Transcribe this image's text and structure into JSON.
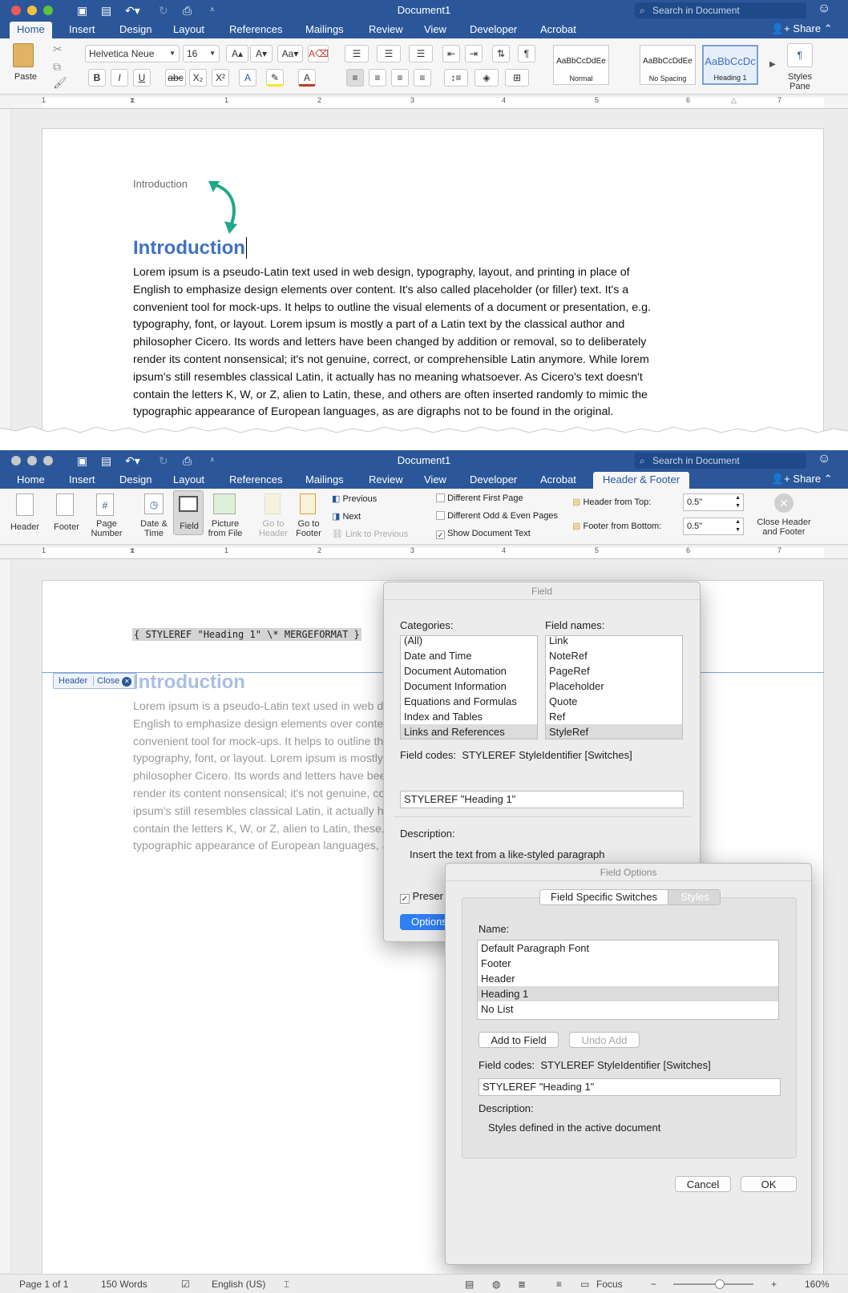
{
  "app": {
    "title": "Document1",
    "search_placeholder": "Search in Document",
    "share_label": "Share",
    "accent": "#2b579a"
  },
  "tabs": [
    {
      "label": "Home"
    },
    {
      "label": "Insert"
    },
    {
      "label": "Design"
    },
    {
      "label": "Layout"
    },
    {
      "label": "References"
    },
    {
      "label": "Mailings"
    },
    {
      "label": "Review"
    },
    {
      "label": "View"
    },
    {
      "label": "Developer"
    },
    {
      "label": "Acrobat"
    }
  ],
  "context_tab": {
    "label": "Header & Footer"
  },
  "home_ribbon": {
    "paste_label": "Paste",
    "font_name": "Helvetica Neue",
    "font_size": "16",
    "styles": [
      {
        "preview": "AaBbCcDdEe",
        "name": "Normal"
      },
      {
        "preview": "AaBbCcDdEe",
        "name": "No Spacing"
      },
      {
        "preview": "AaBbCcDc",
        "name": "Heading 1"
      }
    ],
    "styles_pane_label": "Styles Pane"
  },
  "hf_ribbon": {
    "header_label": "Header",
    "footer_label": "Footer",
    "page_number_label": "Page Number",
    "date_time_label": "Date & Time",
    "field_label": "Field",
    "picture_label": "Picture from File",
    "goto_header_label": "Go to Header",
    "goto_footer_label": "Go to Footer",
    "previous_label": "Previous",
    "next_label": "Next",
    "link_previous_label": "Link to Previous",
    "diff_first_label": "Different First Page",
    "diff_odd_even_label": "Different Odd & Even Pages",
    "show_doc_text_label": "Show Document Text",
    "header_from_top_label": "Header from Top:",
    "header_from_top_value": "0.5\"",
    "footer_from_bottom_label": "Footer from Bottom:",
    "footer_from_bottom_value": "0.5\"",
    "close_label": "Close Header and Footer"
  },
  "document": {
    "header_text": "Introduction",
    "heading": "Introduction",
    "body": "Lorem ipsum is a pseudo-Latin text used in web design, typography, layout, and printing in place of English to emphasize design elements over content. It's also called placeholder (or filler) text. It's a convenient tool for mock-ups. It helps to outline the visual elements of a document or presentation, e.g. typography, font, or layout. Lorem ipsum is mostly a part of a Latin text by the classical author and philosopher Cicero. Its words and letters have been changed by addition or removal, so to deliberately render its content nonsensical; it's not genuine, correct, or comprehensible Latin anymore. While lorem ipsum's still resembles classical Latin, it actually has no meaning whatsoever. As Cicero's text doesn't contain the letters K, W, or Z, alien to Latin, these, and others are often inserted randomly to mimic the typographic appearance of European languages, as are digraphs not to be found in the original.",
    "body_lines": [
      "Lorem ipsum is a pseudo-Latin text used in web design, typography, layout, and printing in place of",
      "English to emphasize design elements over content. It's also called placeholder (or filler) text. It's a",
      "convenient tool for mock-ups. It helps to outline the visual elements of a document or presentation, e.g.",
      "typography, font, or layout. Lorem ipsum is mostly a part of a Latin text by the classical author and",
      "philosopher Cicero. Its words and letters have been changed by addition or removal, so to deliberately",
      "render its content nonsensical; it's not genuine, correct, or comprehensible Latin anymore. While lorem",
      "ipsum's still resembles classical Latin, it actually has no meaning whatsoever. As Cicero's text doesn't",
      "contain the letters K, W, or Z, alien to Latin, these, and others are often inserted randomly to mimic the",
      "typographic appearance of European languages, as are digraphs not to be found in the original."
    ],
    "field_code": "{ STYLEREF \"Heading 1\" \\* MERGEFORMAT }",
    "header_tag": "Header",
    "close_tag": "Close"
  },
  "field_dialog": {
    "title": "Field",
    "categories_label": "Categories:",
    "categories": [
      "(All)",
      "Date and Time",
      "Document Automation",
      "Document Information",
      "Equations and Formulas",
      "Index and Tables",
      "Links and References"
    ],
    "selected_category": "Links and References",
    "field_names_label": "Field names:",
    "field_names": [
      "Link",
      "NoteRef",
      "PageRef",
      "Placeholder",
      "Quote",
      "Ref",
      "StyleRef"
    ],
    "selected_field": "StyleRef",
    "field_codes_label": "Field codes:",
    "field_codes_syntax": "STYLEREF StyleIdentifier [Switches]",
    "field_code_value": "STYLEREF \"Heading 1\"",
    "description_label": "Description:",
    "description": "Insert the text from a like-styled paragraph",
    "preserve_label": "Preser",
    "options_label": "Options"
  },
  "options_dialog": {
    "title": "Field Options",
    "tab_switches": "Field Specific Switches",
    "tab_styles": "Styles",
    "name_label": "Name:",
    "names": [
      "Default Paragraph Font",
      "Footer",
      "Header",
      "Heading 1",
      "No List"
    ],
    "selected_name": "Heading 1",
    "add_label": "Add to Field",
    "undo_label": "Undo Add",
    "field_codes_label": "Field codes:",
    "field_codes_syntax": "STYLEREF StyleIdentifier [Switches]",
    "field_code_value": "STYLEREF \"Heading 1\"",
    "description_label": "Description:",
    "description": "Styles defined in the active document",
    "cancel_label": "Cancel",
    "ok_label": "OK"
  },
  "status": {
    "page": "Page 1 of 1",
    "words": "150 Words",
    "language": "English (US)",
    "focus": "Focus",
    "zoom": "160%"
  }
}
